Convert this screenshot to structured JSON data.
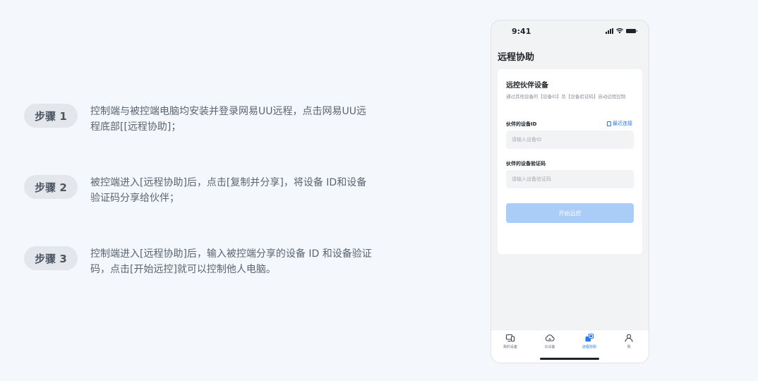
{
  "steps": [
    {
      "badge": "步骤 1",
      "text": "控制端与被控端电脑均安装并登录网易UU远程，点击网易UU远程底部[[远程协助]；"
    },
    {
      "badge": "步骤 2",
      "text": "被控端进入[远程协助]后，点击[复制并分享]，将设备 ID和设备验证码分享给伙伴；"
    },
    {
      "badge": "步骤 3",
      "text": "控制端进入[远程协助]后，输入被控端分享的设备 ID 和设备验证码，点击[开始远控]就可以控制他人电脑。"
    }
  ],
  "phone": {
    "time": "9:41",
    "page_title": "远程协助",
    "card": {
      "title": "远控伙伴设备",
      "description": "通过其他设备的【设备ID】及【设备验证码】自动远程控制",
      "device_id_label": "伙伴的设备ID",
      "recent_link": "最近连接",
      "device_id_placeholder": "请输入设备ID",
      "verify_label": "伙伴的设备验证码",
      "verify_placeholder": "请输入设备验证码",
      "start_button": "开始远控"
    },
    "tabs": [
      {
        "label": "我的设备",
        "icon": "devices-icon"
      },
      {
        "label": "云设备",
        "icon": "cloud-icon"
      },
      {
        "label": "远程协助",
        "icon": "remote-assist-icon",
        "active": true
      },
      {
        "label": "我",
        "icon": "user-icon"
      }
    ],
    "colors": {
      "accent": "#2a78e8",
      "button_disabled": "#a9cdf7",
      "badge_bg": "#e3e7ec"
    }
  }
}
